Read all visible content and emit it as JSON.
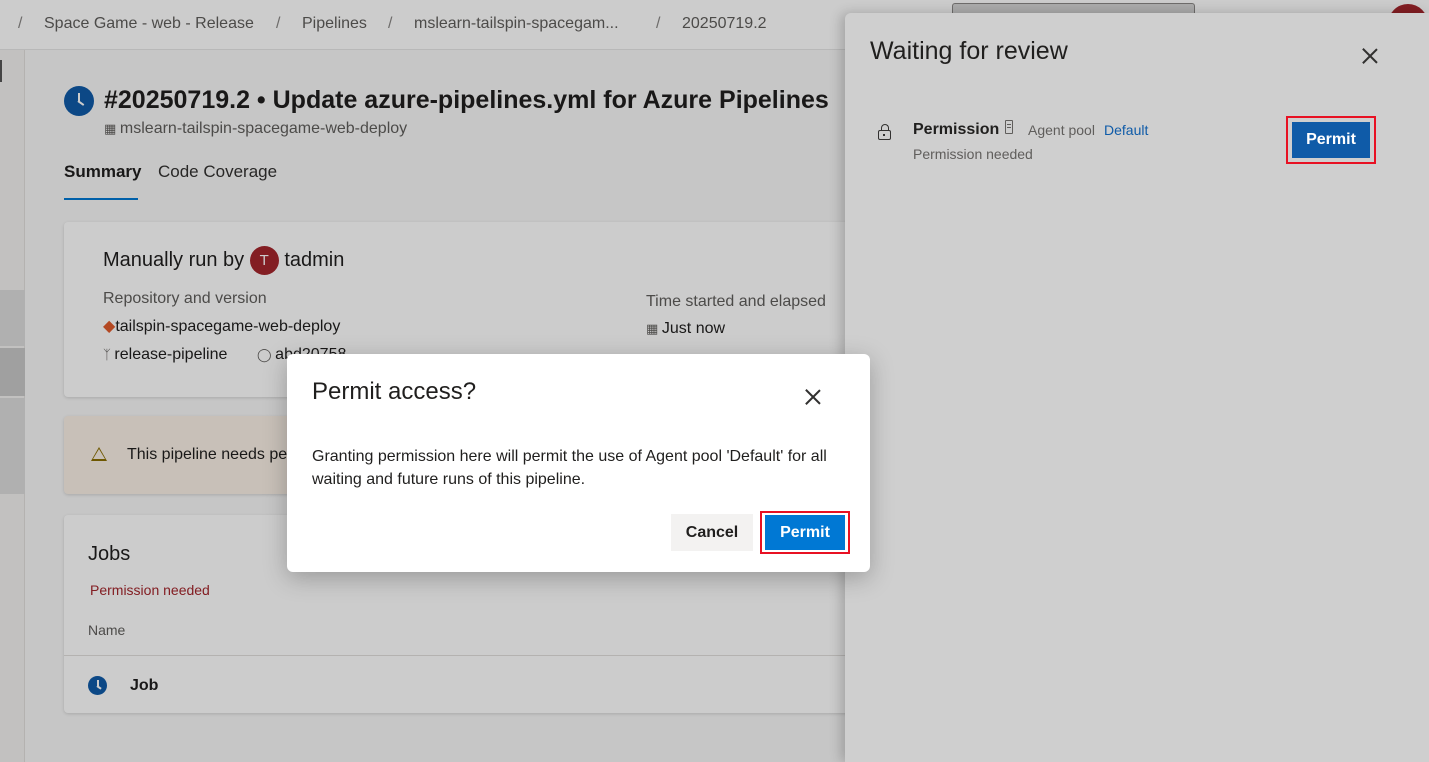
{
  "breadcrumb": {
    "items": [
      "Space Game - web - Release",
      "Pipelines",
      "mslearn-tailspin-spacegam...",
      "20250719.2"
    ],
    "separator": "/"
  },
  "run": {
    "title": "#20250719.2 • Update azure-pipelines.yml for Azure Pipelines",
    "pipeline": "mslearn-tailspin-spacegame-web-deploy"
  },
  "tabs": [
    "Summary",
    "Code Coverage"
  ],
  "summary": {
    "manual_run_prefix": "Manually run by",
    "avatar_initial": "T",
    "user": "tadmin",
    "repo_label": "Repository and version",
    "repo": "tailspin-spacegame-web-deploy",
    "branch": "release-pipeline",
    "commit": "abd20758",
    "time_label": "Time started and elapsed",
    "time_value": "Just now"
  },
  "warning": {
    "text": "This pipeline needs pe"
  },
  "jobs": {
    "title": "Jobs",
    "status": "Permission needed",
    "column_name": "Name",
    "rows": [
      {
        "name": "Job"
      }
    ]
  },
  "review_panel": {
    "title": "Waiting for review",
    "item": {
      "name": "Permission",
      "pool_label": "Agent pool",
      "pool_link": "Default",
      "status": "Permission needed",
      "button": "Permit"
    }
  },
  "dialog": {
    "title": "Permit access?",
    "body": "Granting permission here will permit the use of Agent pool 'Default' for all waiting and future runs of this pipeline.",
    "cancel": "Cancel",
    "permit": "Permit"
  },
  "colors": {
    "accent": "#0078d4",
    "highlight": "#e81123",
    "error": "#a4262c"
  }
}
